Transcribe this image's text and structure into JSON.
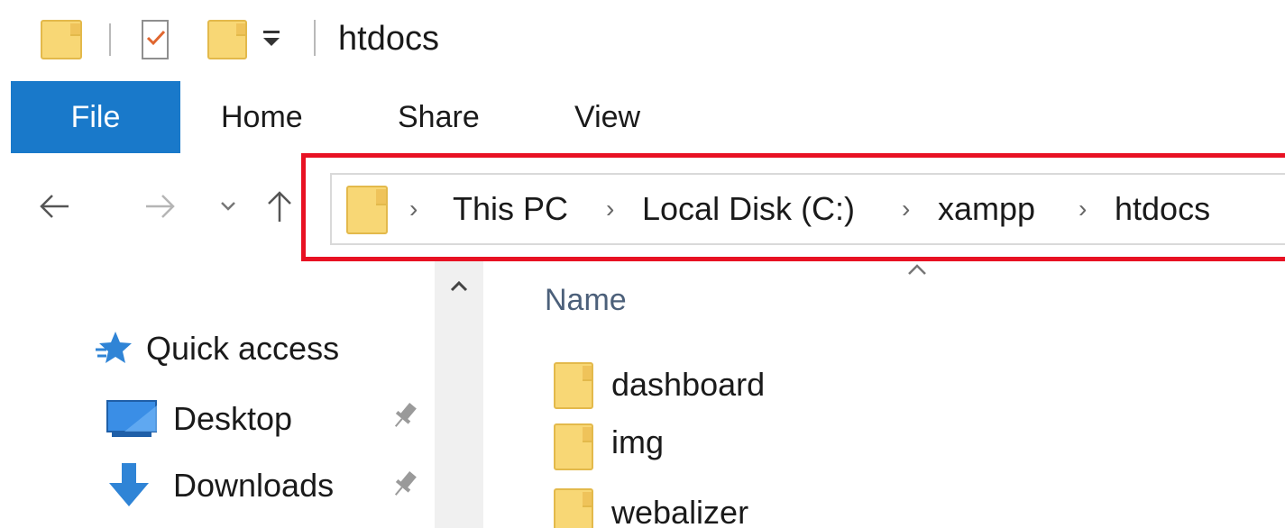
{
  "window": {
    "title": "htdocs"
  },
  "ribbon": {
    "tabs": [
      {
        "label": "File"
      },
      {
        "label": "Home"
      },
      {
        "label": "Share"
      },
      {
        "label": "View"
      }
    ]
  },
  "address_bar": {
    "breadcrumbs": [
      "This PC",
      "Local Disk (C:)",
      "xampp",
      "htdocs"
    ]
  },
  "navigation_pane": {
    "items": [
      {
        "label": "Quick access",
        "icon": "star-icon"
      },
      {
        "label": "Desktop",
        "icon": "desktop-icon",
        "pinned": true
      },
      {
        "label": "Downloads",
        "icon": "download-arrow-icon",
        "pinned": true
      }
    ]
  },
  "file_list": {
    "column_header": "Name",
    "items": [
      {
        "name": "dashboard",
        "icon": "folder-icon"
      },
      {
        "name": "img",
        "icon": "folder-icon"
      },
      {
        "name": "webalizer",
        "icon": "folder-icon"
      }
    ]
  },
  "colors": {
    "file_tab": "#1979ca",
    "folder": "#f8d775",
    "highlight": "#e81123"
  }
}
